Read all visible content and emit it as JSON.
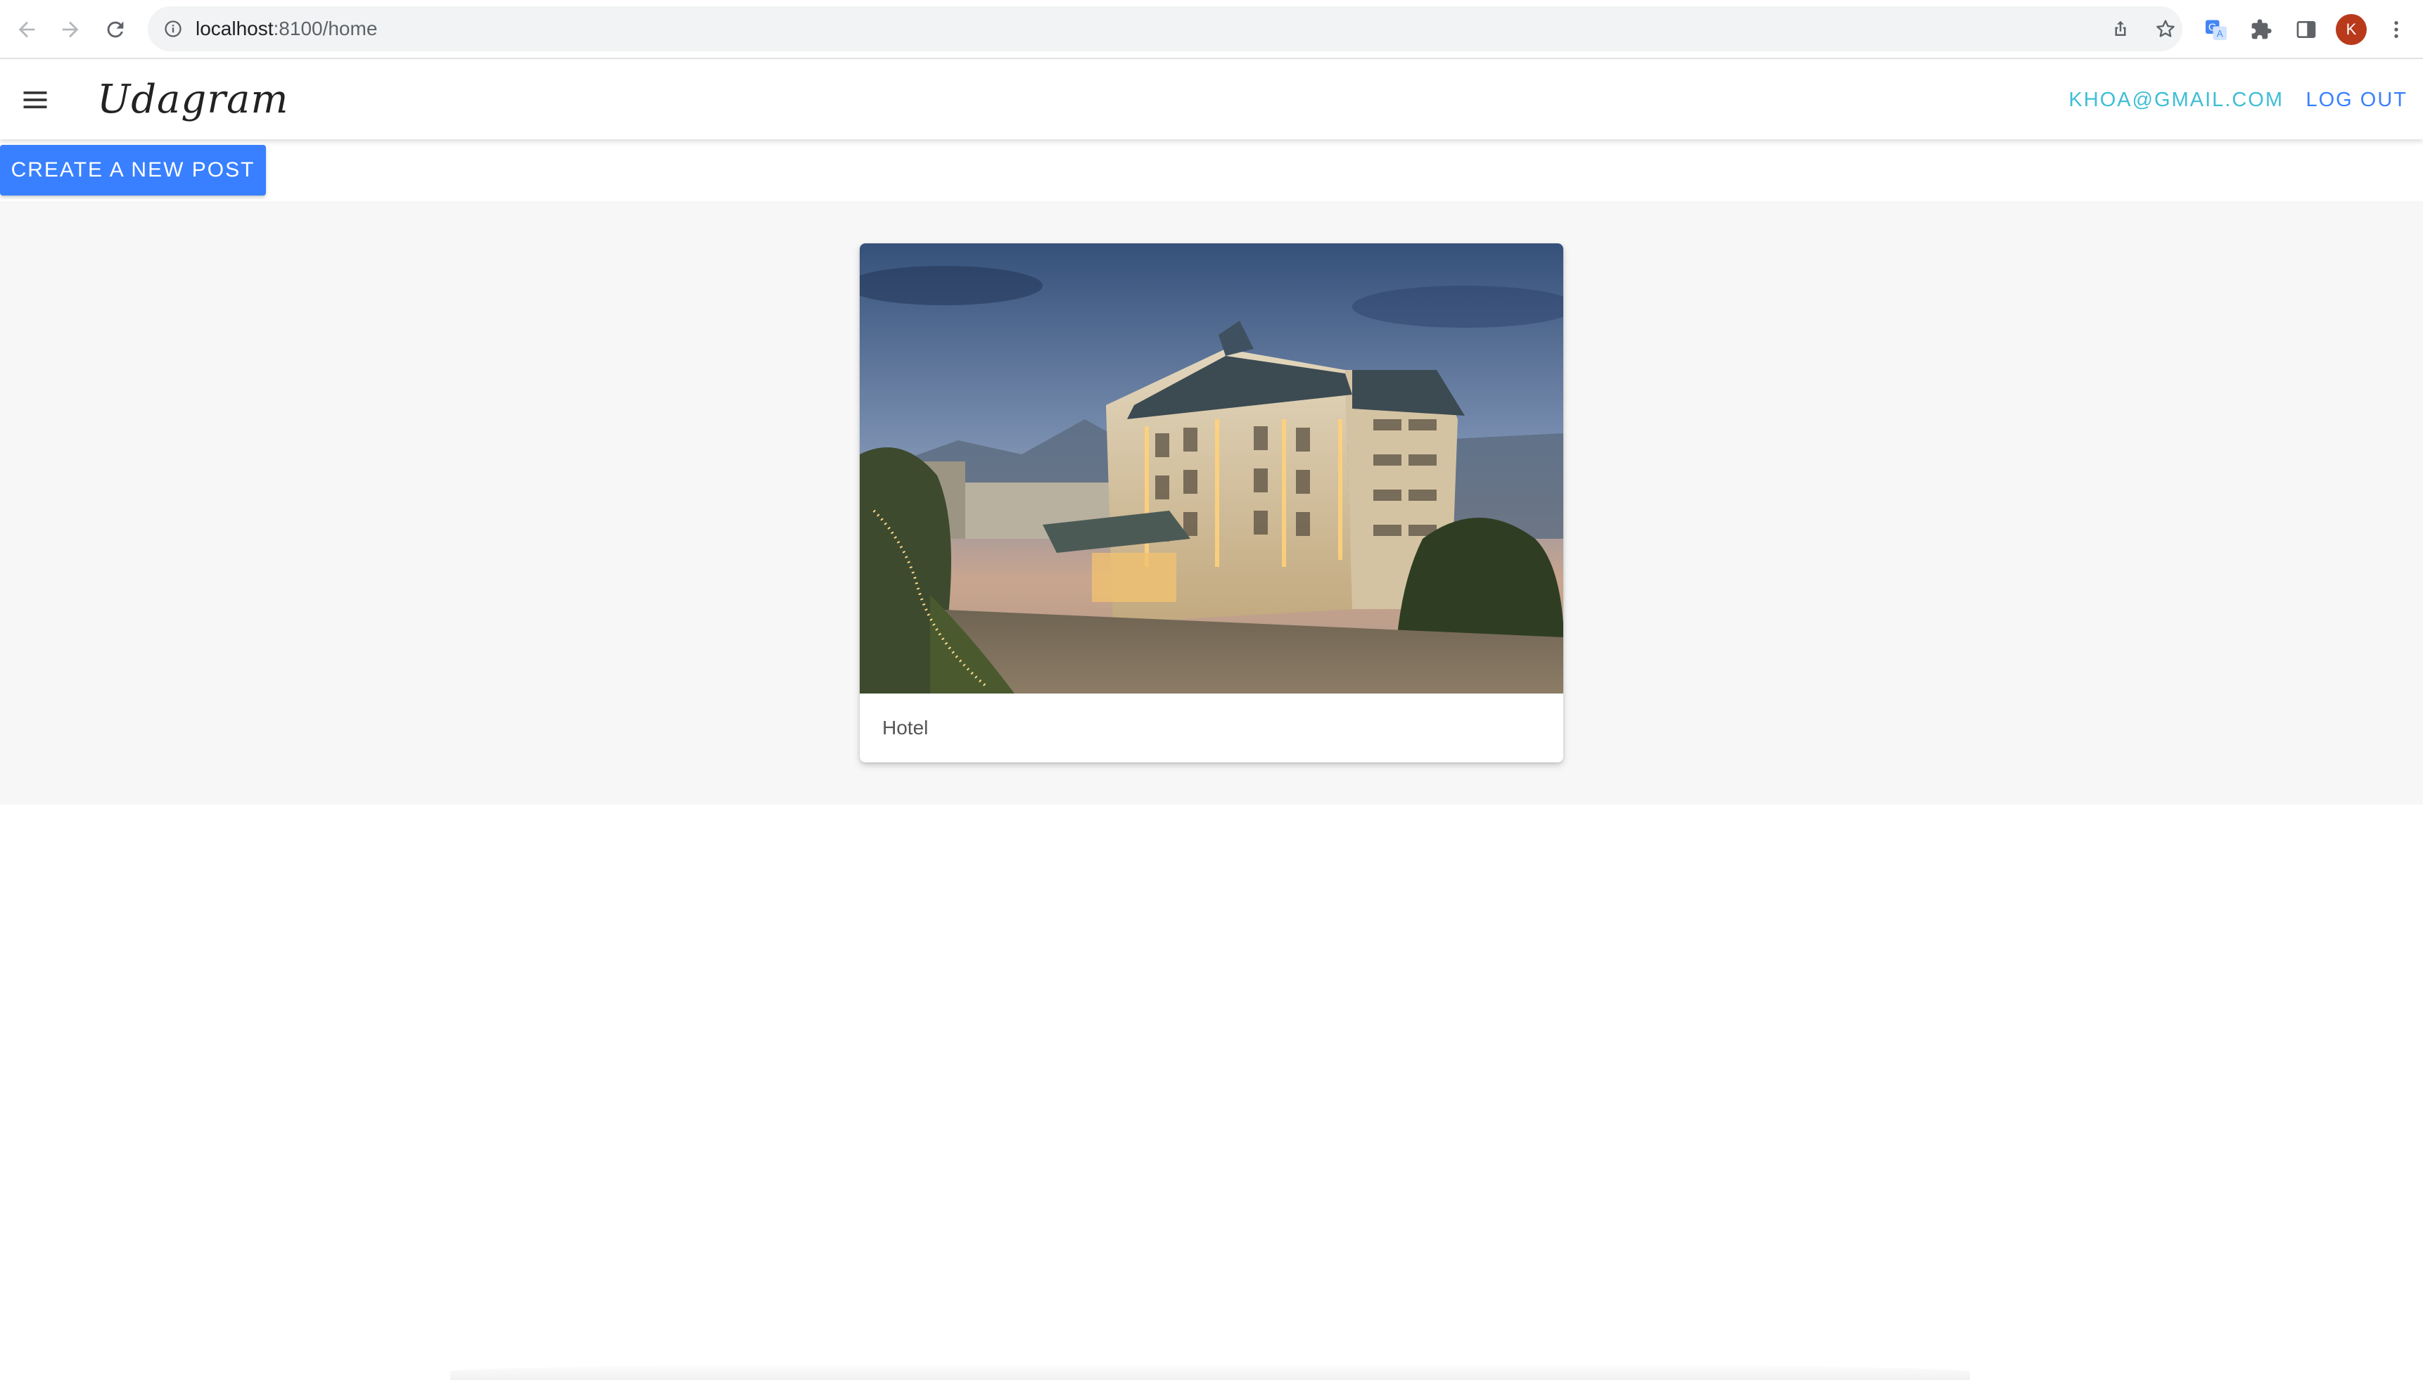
{
  "browser": {
    "url_host": "localhost",
    "url_rest": ":8100/home",
    "profile_initial": "K",
    "icons": {
      "back": "arrow-left-icon",
      "forward": "arrow-right-icon",
      "reload": "reload-icon",
      "site_info": "info-icon",
      "share": "share-icon",
      "bookmark": "star-icon",
      "translate": "translate-icon",
      "extensions": "puzzle-icon",
      "side_panel": "side-panel-icon",
      "menu": "kebab-menu-icon"
    }
  },
  "app": {
    "logo": "Udagram",
    "user_email": "KHOA@GMAIL.COM",
    "logout_label": "LOG OUT",
    "menu_icon": "hamburger-icon",
    "create_post_label": "CREATE A NEW POST",
    "colors": {
      "primary": "#3880ff",
      "email": "#3ebed6",
      "feed_background": "#f7f7f7"
    }
  },
  "feed": {
    "posts": [
      {
        "caption": "Hotel"
      }
    ]
  }
}
